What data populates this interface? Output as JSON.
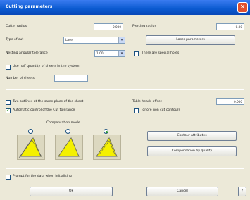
{
  "window": {
    "title": "Cutting parameters",
    "close": "×"
  },
  "left": {
    "cutter_radius_label": "Cutter radius",
    "cutter_radius_value": "0.000",
    "type_of_cut_label": "Type of cut",
    "type_of_cut_value": "Laser",
    "angular_tolerance_label": "Nesting angular tolerance",
    "angular_tolerance_value": "1.00",
    "use_half_sheets_label": "Use half quantity of sheets in the system",
    "number_sheets_label": "Number of sheets",
    "number_sheets_value": "",
    "two_outlines_label": "Two outlines at the same place of the sheet",
    "automatic_control_label": "Automatic control of the Cut tolerance",
    "compensation_label": "Compensation mode"
  },
  "right": {
    "piercing_radius_label": "Piercing radius",
    "piercing_radius_value": "0.00",
    "laser_parameters_button": "Laser parameters",
    "special_holes_label": "There are special holes",
    "table_heads_offset_label": "Table heads offset",
    "table_heads_offset_value": "0.000",
    "ignore_non_cut_contours_label": "Ignore non cut contours",
    "contour_attributes_button": "Contour attributes",
    "compensation_quality_button": "Compensation by quality"
  },
  "footer": {
    "prompt_label": "Prompt for the data when initialising",
    "ok_button": "Ok",
    "cancel_button": "Cancel",
    "help_button": "?"
  },
  "colors": {
    "accent_yellow": "#f4f000",
    "title_blue": "#0a5ad0"
  }
}
